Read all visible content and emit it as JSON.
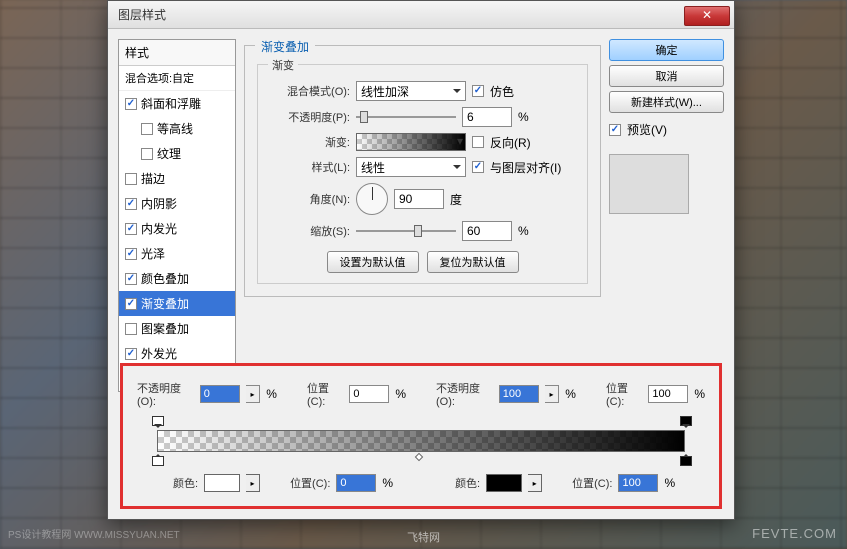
{
  "dialog": {
    "title": "图层样式",
    "styles_header": "样式",
    "blend_options": "混合选项:自定",
    "items": [
      {
        "label": "斜面和浮雕",
        "checked": true,
        "selected": false
      },
      {
        "label": "等高线",
        "checked": false,
        "selected": false,
        "indent": true
      },
      {
        "label": "纹理",
        "checked": false,
        "selected": false,
        "indent": true
      },
      {
        "label": "描边",
        "checked": false,
        "selected": false
      },
      {
        "label": "内阴影",
        "checked": true,
        "selected": false
      },
      {
        "label": "内发光",
        "checked": true,
        "selected": false
      },
      {
        "label": "光泽",
        "checked": true,
        "selected": false
      },
      {
        "label": "颜色叠加",
        "checked": true,
        "selected": false
      },
      {
        "label": "渐变叠加",
        "checked": true,
        "selected": true
      },
      {
        "label": "图案叠加",
        "checked": false,
        "selected": false
      },
      {
        "label": "外发光",
        "checked": true,
        "selected": false
      },
      {
        "label": "投影",
        "checked": true,
        "selected": false
      }
    ]
  },
  "main": {
    "section_title": "渐变叠加",
    "inner_title": "渐变",
    "blend_mode_label": "混合模式(O):",
    "blend_mode_value": "线性加深",
    "dither_label": "仿色",
    "opacity_label": "不透明度(P):",
    "opacity_value": "6",
    "pct": "%",
    "gradient_label": "渐变:",
    "reverse_label": "反向(R)",
    "style_label": "样式(L):",
    "style_value": "线性",
    "align_label": "与图层对齐(I)",
    "angle_label": "角度(N):",
    "angle_value": "90",
    "angle_unit": "度",
    "scale_label": "缩放(S):",
    "scale_value": "60",
    "make_default": "设置为默认值",
    "reset_default": "复位为默认值"
  },
  "buttons": {
    "ok": "确定",
    "cancel": "取消",
    "new_style": "新建样式(W)...",
    "preview": "预览(V)"
  },
  "editor": {
    "opacity_label": "不透明度(O):",
    "position_label": "位置(C):",
    "color_label": "颜色:",
    "pct": "%",
    "opacity1": "0",
    "position1": "0",
    "opacity2": "100",
    "position2": "100",
    "color_position1": "0",
    "color_position2": "100"
  },
  "watermarks": {
    "center": "飞特网",
    "right": "FEVTE.COM",
    "left": "PS设计教程网  WWW.MISSYUAN.NET"
  }
}
